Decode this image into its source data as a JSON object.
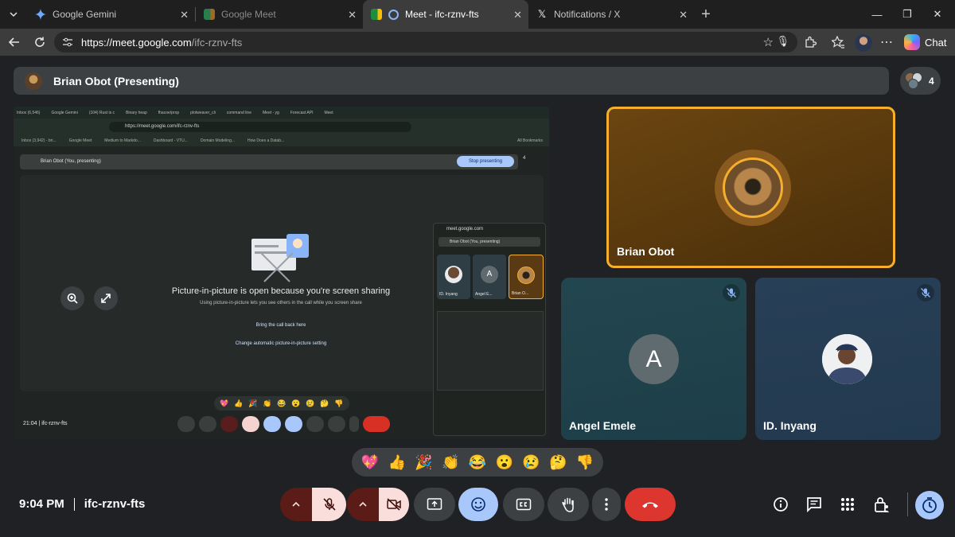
{
  "browser": {
    "tabs": [
      {
        "title": "Google Gemini",
        "active": false
      },
      {
        "title": "Google Meet",
        "active": false
      },
      {
        "title": "Meet - ifc-rznv-fts",
        "active": true
      },
      {
        "title": "Notifications / X",
        "active": false
      }
    ],
    "url_host": "https://meet.google.com",
    "url_path": "/ifc-rznv-fts",
    "chat_label": "Chat"
  },
  "meet": {
    "presenting_label": "Brian Obot (Presenting)",
    "participant_count": "4",
    "shared_screen": {
      "tabs": [
        "Inbox (6,546)",
        "Google Gemini",
        "(104) Rust is c",
        "Binary heap",
        "fhacoe/prop",
        "plotweaver_cli",
        "command line",
        "Meet - yg",
        "Forecast API",
        "Meet"
      ],
      "url": "https://meet.google.com/ifc-rznv-fts",
      "bookmarks": [
        "Inbox (3,942) - bri...",
        "Google Meet",
        "Medium to Markdo...",
        "Dashboard - VTU...",
        "Domain Modeling...",
        "How Does a Datab...",
        "All Bookmarks"
      ],
      "present_bar": "Brian Obot (You, presenting)",
      "stop_button": "Stop presenting",
      "count": "4",
      "pip_message": "Picture-in-picture is open because you're screen sharing",
      "pip_sub": "Using picture-in-picture lets you see others in the call while you screen share",
      "link_bring_back": "Bring the call back here",
      "link_change_setting": "Change automatic picture-in-picture setting",
      "time": "21:04",
      "code": "ifc-rznv-fts",
      "pip_window": {
        "url": "meet.google.com",
        "title": "Brian Obot (You, presenting)",
        "tiles": [
          "ID. Inyang",
          "Angel E...",
          "Brian O..."
        ]
      }
    },
    "participants": [
      {
        "name": "Brian Obot"
      },
      {
        "name": "Angel Emele",
        "initial": "A"
      },
      {
        "name": "ID. Inyang"
      }
    ],
    "reactions": [
      "💖",
      "👍",
      "🎉",
      "👏",
      "😂",
      "😮",
      "😢",
      "🤔",
      "👎"
    ],
    "time": "9:04 PM",
    "meeting_code": "ifc-rznv-fts"
  },
  "colors": {
    "speaker_border": "#f6ae2d",
    "end_call": "#dc362e",
    "active_blue": "#a8c7fa"
  }
}
